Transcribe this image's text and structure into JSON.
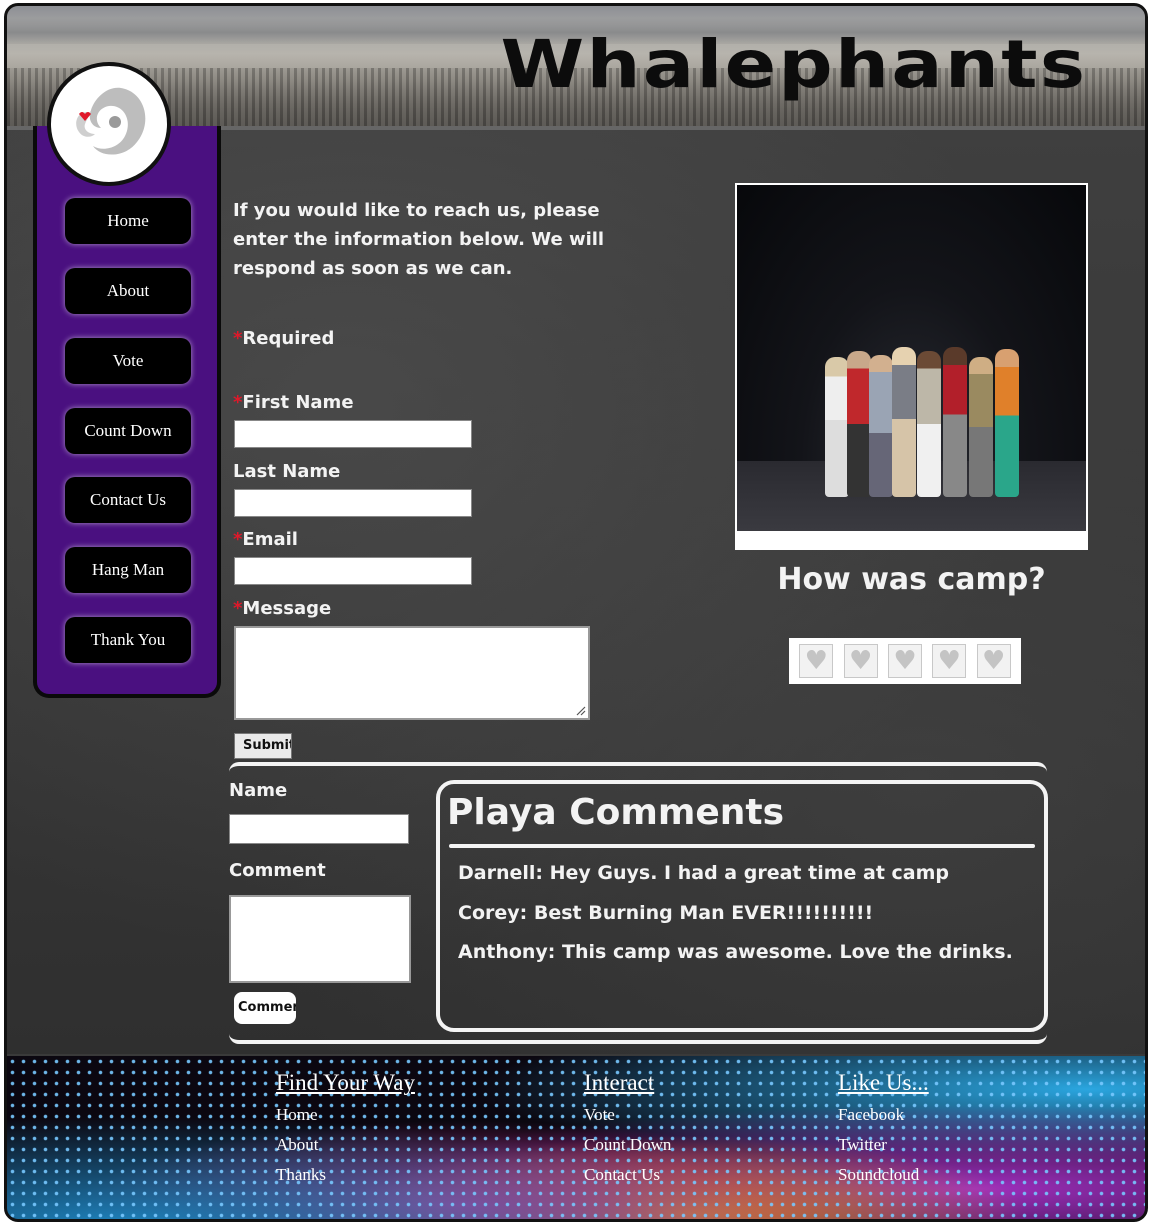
{
  "header": {
    "site_title": "Whalephants"
  },
  "nav": {
    "items": [
      {
        "label": "Home"
      },
      {
        "label": "About"
      },
      {
        "label": "Vote"
      },
      {
        "label": "Count Down"
      },
      {
        "label": "Contact Us"
      },
      {
        "label": "Hang Man"
      },
      {
        "label": "Thank You"
      }
    ]
  },
  "contact_form": {
    "intro": "If you would like to reach us, please enter the information below. We will respond as soon as we can.",
    "required_note": "Required",
    "required_star": "*",
    "first_name_label": "First Name",
    "last_name_label": "Last Name",
    "email_label": "Email",
    "message_label": "Message",
    "submit_label": "Submit"
  },
  "photo_panel": {
    "question": "How was camp?",
    "rating_max": 5,
    "rating_value": 0
  },
  "comment_form": {
    "name_label": "Name",
    "comment_label": "Comment",
    "button_label": "Comment"
  },
  "playa_comments": {
    "title": "Playa Comments",
    "items": [
      {
        "text": "Darnell: Hey Guys. I had a great time at camp"
      },
      {
        "text": "Corey: Best Burning Man EVER!!!!!!!!!!"
      },
      {
        "text": "Anthony: This camp was awesome. Love the drinks."
      }
    ]
  },
  "footer": {
    "columns": [
      {
        "heading": "Find Your Way",
        "links": [
          "Home",
          "About",
          "Thanks"
        ]
      },
      {
        "heading": "Interact",
        "links": [
          "Vote",
          "Count Down",
          "Contact Us"
        ]
      },
      {
        "heading": "Like Us...",
        "links": [
          "Facebook",
          "Twitter",
          "Soundcloud"
        ]
      }
    ]
  },
  "colors": {
    "nav_bg": "#4a1080",
    "required_star": "#e0182a",
    "chalk_text": "#f3f3f3"
  }
}
